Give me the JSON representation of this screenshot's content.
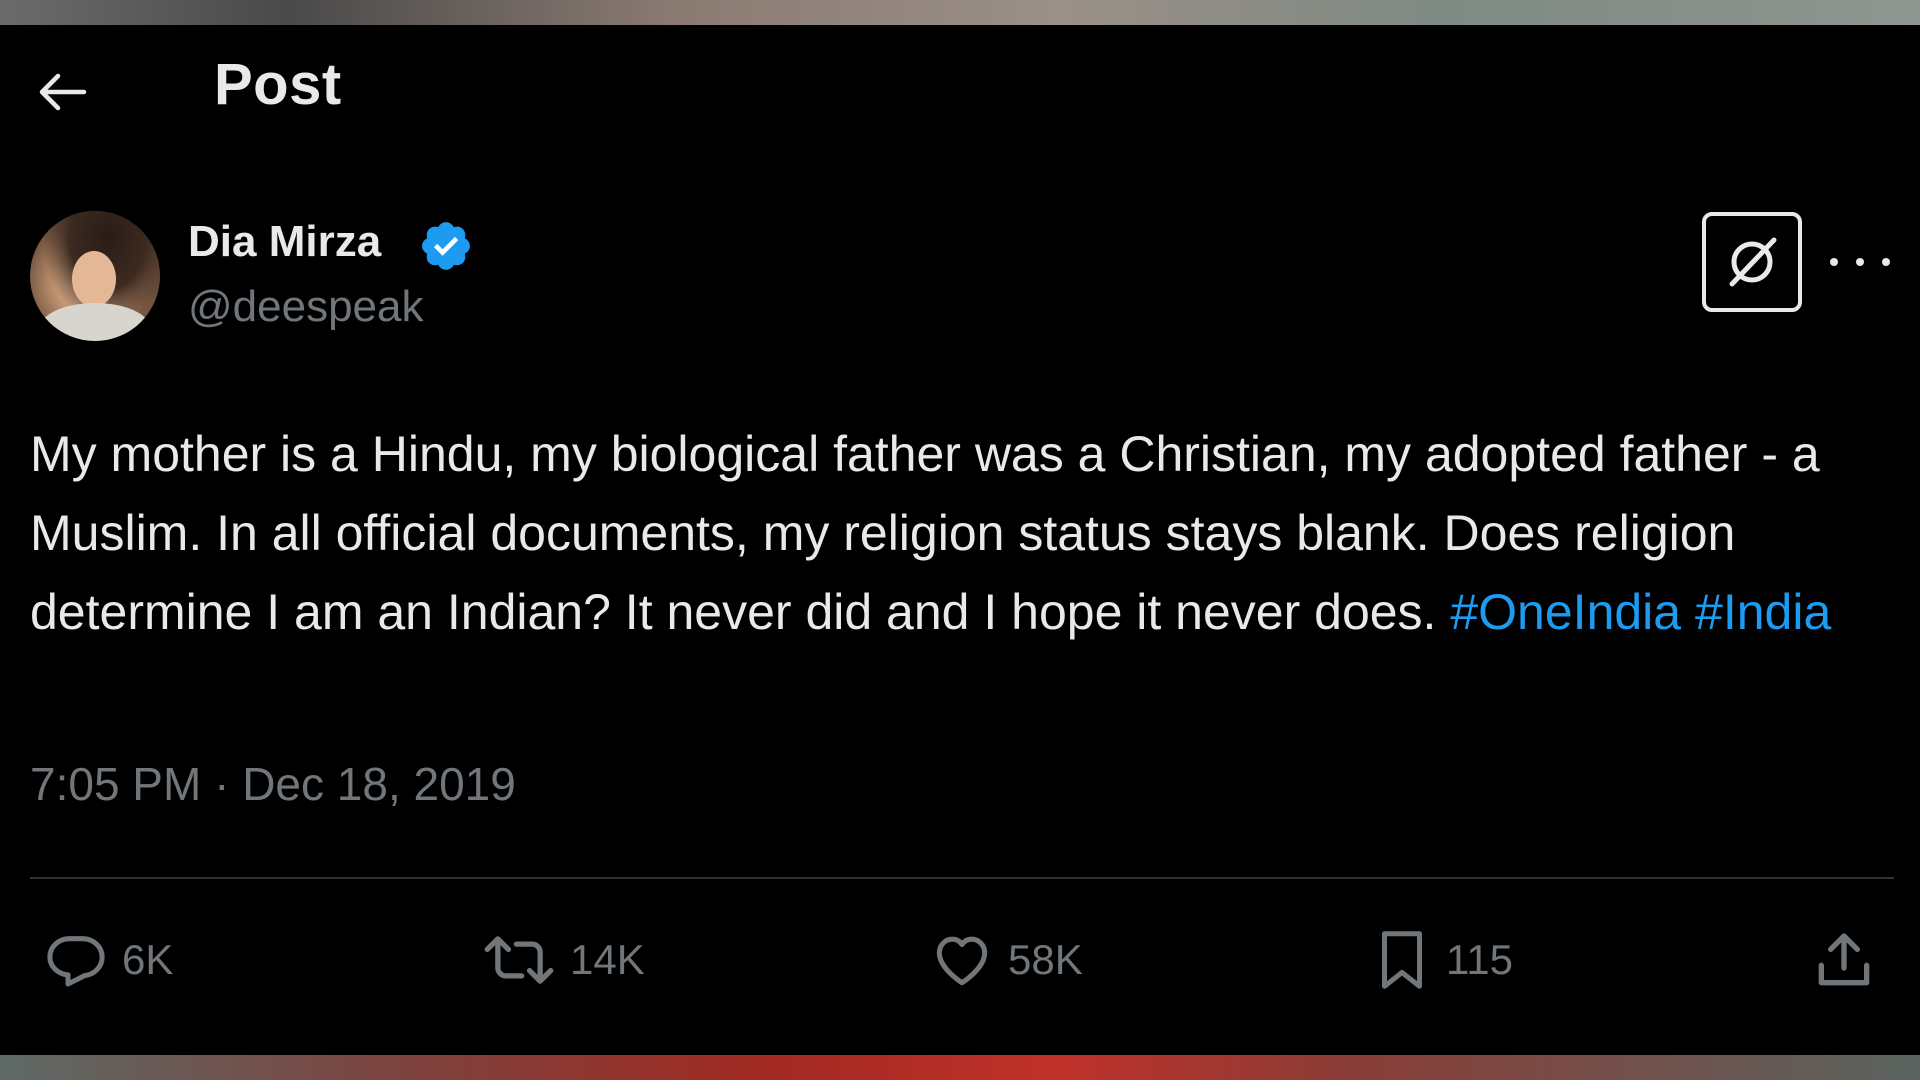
{
  "header": {
    "title": "Post"
  },
  "post": {
    "author": {
      "name": "Dia Mirza",
      "handle": "@deespeak",
      "verified": true
    },
    "text": "My mother is a Hindu, my biological father was a Christian, my adopted father - a Muslim. In all official documents, my religion status stays blank. Does religion determine I am an Indian? It never did and I hope it never does.",
    "hashtags": [
      "#OneIndia",
      "#India"
    ],
    "timestamp": "7:05 PM · Dec 18, 2019"
  },
  "actions": {
    "replies": "6K",
    "reposts": "14K",
    "likes": "58K",
    "bookmarks": "115"
  },
  "colors": {
    "background": "#000000",
    "text": "#e7e9ea",
    "muted": "#71767b",
    "accent": "#1d9bf0",
    "divider": "#2f3336"
  },
  "icons": {
    "back": "arrow-left-icon",
    "verified": "verified-badge-icon",
    "grok": "grok-icon",
    "more": "more-dots-icon",
    "reply": "reply-icon",
    "repost": "repost-icon",
    "like": "heart-icon",
    "bookmark": "bookmark-icon",
    "share": "share-icon"
  }
}
